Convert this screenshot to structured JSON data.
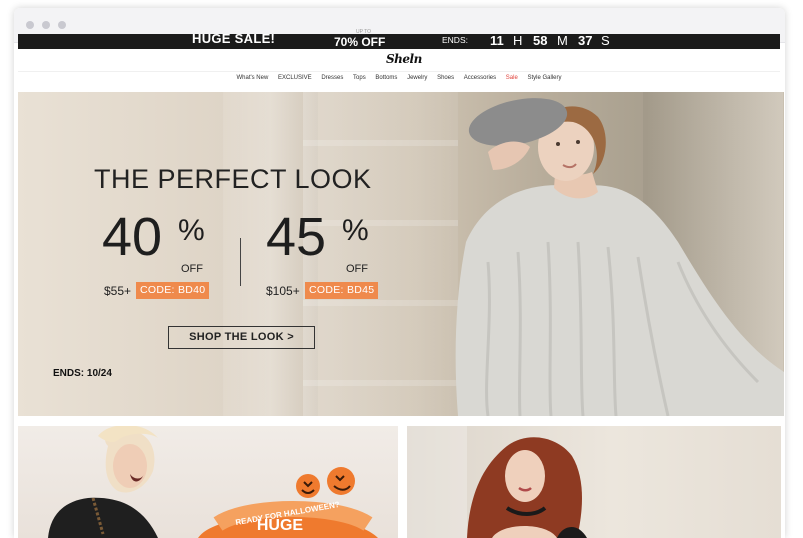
{
  "banner": {
    "sale_text": "HUGE SALE!",
    "upto_text": "UP TO",
    "discount_text": "70% OFF",
    "ends_label": "ENDS:",
    "hours": "11",
    "hours_unit": "H",
    "minutes": "58",
    "minutes_unit": "M",
    "seconds": "37",
    "seconds_unit": "S"
  },
  "header": {
    "logo": "Sheln"
  },
  "nav": {
    "items": [
      "What's New",
      "EXCLUSIVE",
      "Dresses",
      "Tops",
      "Bottoms",
      "Jewelry",
      "Shoes",
      "Accessories",
      "Sale",
      "Style Gallery"
    ]
  },
  "hero": {
    "title": "THE PERFECT LOOK",
    "offer1": {
      "number": "40",
      "percent": "%",
      "off": "OFF",
      "min": "$55+",
      "code": "CODE: BD40"
    },
    "offer2": {
      "number": "45",
      "percent": "%",
      "off": "OFF",
      "min": "$105+",
      "code": "CODE: BD45"
    },
    "cta": "SHOP THE LOOK  >",
    "ends": "ENDS: 10/24"
  },
  "tiles": {
    "tile1_ribbon": "READY FOR HALLOWEEN?",
    "tile1_heading": "HUGE"
  },
  "colors": {
    "accent_orange": "#ef8a4c",
    "sale_red": "#e0413a",
    "banner_bg": "#1b1b1b"
  }
}
